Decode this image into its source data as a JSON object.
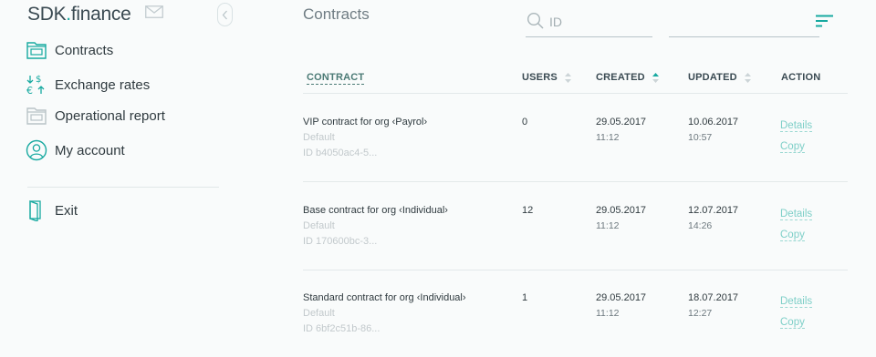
{
  "brand": {
    "logo_main": "SDK",
    "logo_dot": ".",
    "logo_tail": "finance"
  },
  "sidebar": {
    "items": [
      {
        "label": "Contracts"
      },
      {
        "label": "Exchange rates"
      },
      {
        "label": "Operational report"
      },
      {
        "label": "My account"
      }
    ],
    "exit_label": "Exit"
  },
  "main": {
    "title": "Contracts",
    "search": {
      "placeholder": "ID",
      "value": ""
    }
  },
  "table": {
    "headers": {
      "contract": "CONTRACT",
      "users": "USERS",
      "created": "CREATED",
      "updated": "UPDATED",
      "action": "ACTION"
    },
    "sorted_column": "created",
    "rows": [
      {
        "name": "VIP contract for org ‹Payrol›",
        "sub": "Default",
        "id": "ID b4050ac4-5...",
        "users": "0",
        "created_date": "29.05.2017",
        "created_time": "11:12",
        "updated_date": "10.06.2017",
        "updated_time": "10:57",
        "details": "Details",
        "copy": "Copy"
      },
      {
        "name": "Base contract for org ‹Individual›",
        "sub": "Default",
        "id": "ID 170600bc-3...",
        "users": "12",
        "created_date": "29.05.2017",
        "created_time": "11:12",
        "updated_date": "12.07.2017",
        "updated_time": "14:26",
        "details": "Details",
        "copy": "Copy"
      },
      {
        "name": "Standard contract for org ‹Individual›",
        "sub": "Default",
        "id": "ID 6bf2c51b-86...",
        "users": "1",
        "created_date": "29.05.2017",
        "created_time": "11:12",
        "updated_date": "18.07.2017",
        "updated_time": "12:27",
        "details": "Details",
        "copy": "Copy"
      }
    ]
  },
  "colors": {
    "accent": "#17a9a0",
    "link": "#7ecfc8",
    "text": "#2f3a3f",
    "muted": "#c2c9cc",
    "background": "#f9fbfb"
  },
  "icons": [
    "mail-icon",
    "chevron-left-icon",
    "contracts-icon",
    "exchange-rates-icon",
    "report-icon",
    "account-icon",
    "exit-icon",
    "search-icon",
    "filter-icon",
    "sort-icon"
  ]
}
